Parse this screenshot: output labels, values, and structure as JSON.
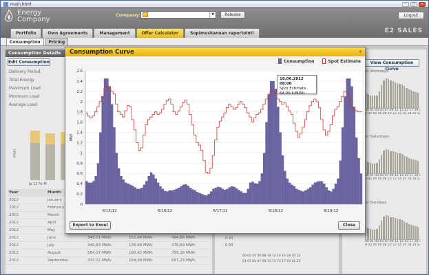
{
  "window": {
    "title": "main.html"
  },
  "header": {
    "logo_line1": "Energy",
    "logo_line2": "Company",
    "company_label": "Company:",
    "company_value": "",
    "release_label": "Release",
    "logout_label": "Logout",
    "brand_right": "E2 SALES",
    "nav_tabs": [
      "Portfolio",
      "Own Agreements",
      "Management",
      "Offer Calculator",
      "Sopimuskannan raportointi"
    ]
  },
  "subtabs": [
    "Consumption",
    "Pricing"
  ],
  "details": {
    "title": "Consumption Details",
    "edit_label": "Edit Consumption",
    "fields": [
      "Delivery Period",
      "Total Energy",
      "Maximum Load",
      "Minimum Load",
      "Average Load"
    ],
    "bar_ylabel": "MWh",
    "bar_xlabels": "Ja 12   Fe   M",
    "table_headers": [
      "Year",
      "Month",
      "",
      "",
      ""
    ],
    "table_rows": [
      [
        "2012",
        "January",
        "",
        "",
        ""
      ],
      [
        "2012",
        "February",
        "",
        "",
        ""
      ],
      [
        "2012",
        "March",
        "",
        "",
        ""
      ],
      [
        "2012",
        "April",
        "",
        "",
        ""
      ],
      [
        "2012",
        "May",
        "",
        "",
        ""
      ],
      [
        "2012",
        "June",
        "343,01 MWh",
        "151,64 MWh",
        "494,66 MWh"
      ],
      [
        "2012",
        "July",
        "349,83 MWh",
        "126,98 MWh",
        "476,69 MWh"
      ],
      [
        "2012",
        "August",
        "584,07 MWh",
        "180,42 MWh",
        "755,16 MWh"
      ],
      [
        "2012",
        "September",
        "332,12 MWh",
        "164,98 MWh",
        "697,23 MWh"
      ]
    ]
  },
  "right_panel": {
    "view_curve_label": "View Consumption Curve",
    "mini_captions": [
      "er Workdays",
      "er Saturdays",
      "er Sundays"
    ],
    "mini_axis": "00 01 03 05 07 09 11 13 15 17 19 21 23",
    "mini_axis2": "0 02 04 06 08 10 12 14 16 18 20 22",
    "mid_axis": "00 02 04 06 08 10 12 14 16 18 20 22",
    "mid_axis2": "01 03 05 07 09 11 13 15 17 19 21 23",
    "mid_ticks": [
      "0.20",
      "0.00"
    ]
  },
  "modal": {
    "title": "Consumption Curve",
    "close_x": "×",
    "legend": [
      "Consumption",
      "Spot Estimate"
    ],
    "tooltip": {
      "line1": "18.06.2012 08:00",
      "line2": "Spot Estimate",
      "line3": "64,99 €/MWh"
    },
    "export_label": "Export to Excel",
    "close_label": "Close"
  },
  "chart_data": {
    "type": "area",
    "ylabel": "MW",
    "ylim": [
      0,
      2.6
    ],
    "yticks": [
      "0",
      "0.2",
      "0.4",
      "0.6",
      "0.8",
      "1",
      "1.2",
      "1.4",
      "1.6",
      "1.8",
      "2",
      "2.2",
      "2.4",
      "2.6"
    ],
    "xticks": [
      "6/15/12",
      "6/16/12",
      "6/17/12",
      "6/18/12",
      "6/19/12"
    ],
    "x": [
      0,
      1,
      2,
      3,
      4,
      5,
      6,
      7,
      8,
      9,
      10,
      11,
      12,
      13,
      14,
      15,
      16,
      17,
      18,
      19,
      20,
      21,
      22,
      23,
      24,
      25,
      26,
      27,
      28,
      29,
      30,
      31,
      32,
      33,
      34,
      35,
      36,
      37,
      38,
      39,
      40,
      41,
      42,
      43,
      44,
      45,
      46,
      47,
      48,
      49,
      50,
      51,
      52,
      53,
      54,
      55,
      56,
      57,
      58,
      59,
      60,
      61,
      62,
      63,
      64,
      65,
      66,
      67,
      68,
      69,
      70,
      71,
      72,
      73,
      74,
      75,
      76,
      77,
      78,
      79,
      80,
      81,
      82,
      83,
      84,
      85,
      86,
      87,
      88,
      89,
      90,
      91,
      92,
      93,
      94,
      95,
      96,
      97,
      98,
      99,
      100,
      101,
      102,
      103,
      104,
      105,
      106,
      107,
      108,
      109,
      110,
      111,
      112,
      113,
      114,
      115,
      116,
      117,
      118,
      119
    ],
    "series": [
      {
        "name": "Consumption",
        "color": "#6a64a0",
        "values": [
          0.45,
          0.42,
          0.42,
          0.45,
          0.55,
          0.8,
          1.4,
          2.1,
          2.45,
          2.45,
          2.3,
          1.95,
          1.5,
          1.0,
          0.7,
          0.55,
          0.48,
          0.42,
          0.4,
          0.38,
          0.36,
          0.33,
          0.3,
          0.3,
          0.32,
          0.38,
          0.45,
          0.55,
          0.62,
          0.58,
          0.5,
          0.42,
          0.35,
          0.3,
          0.26,
          0.25,
          0.27,
          0.27,
          0.28,
          0.3,
          0.32,
          0.35,
          0.38,
          0.39,
          0.36,
          0.32,
          0.29,
          0.27,
          0.24,
          0.22,
          0.2,
          0.18,
          0.17,
          0.2,
          0.25,
          0.3,
          0.32,
          0.34,
          0.33,
          0.3,
          0.28,
          0.3,
          0.33,
          0.35,
          0.34,
          0.31,
          0.28,
          0.25,
          0.22,
          0.22,
          0.3,
          0.42,
          0.44,
          0.41,
          0.4,
          0.45,
          0.6,
          1.0,
          1.6,
          2.15,
          2.4,
          2.4,
          2.25,
          1.9,
          1.4,
          0.95,
          0.65,
          0.5,
          0.42,
          0.38,
          0.35,
          0.3,
          0.28,
          0.26,
          0.25,
          0.27,
          0.3,
          0.33,
          0.38,
          0.42,
          0.44,
          0.45,
          0.45,
          0.4,
          0.33,
          0.27,
          0.25,
          0.3,
          0.4,
          0.5,
          0.85,
          1.5,
          2.1,
          2.45,
          2.45,
          2.3,
          1.9,
          1.3,
          0.9,
          0.6
        ]
      },
      {
        "name": "Spot Estimate",
        "color": "#d23a2a",
        "values": [
          1.78,
          1.72,
          1.68,
          1.72,
          1.8,
          1.9,
          2.0,
          2.1,
          2.25,
          2.3,
          2.25,
          2.2,
          2.15,
          1.95,
          1.8,
          1.75,
          1.7,
          1.82,
          1.92,
          1.9,
          1.65,
          1.45,
          1.2,
          1.05,
          1.1,
          1.35,
          1.55,
          1.65,
          1.7,
          1.75,
          1.8,
          1.75,
          1.78,
          1.85,
          1.95,
          2.02,
          2.05,
          1.95,
          1.8,
          1.75,
          1.82,
          1.9,
          1.98,
          2.03,
          1.95,
          1.75,
          1.55,
          1.35,
          1.2,
          1.15,
          1.05,
          0.85,
          0.62,
          0.6,
          0.7,
          0.95,
          1.25,
          1.5,
          1.62,
          1.7,
          1.78,
          1.88,
          1.95,
          1.9,
          1.85,
          1.88,
          1.95,
          2.0,
          1.95,
          1.88,
          1.78,
          1.7,
          1.6,
          1.68,
          1.75,
          1.78,
          1.85,
          1.95,
          2.05,
          2.1,
          2.2,
          2.2,
          2.15,
          2.05,
          2.0,
          1.95,
          1.98,
          1.9,
          1.82,
          1.75,
          1.58,
          1.42,
          1.3,
          1.38,
          1.5,
          1.65,
          1.8,
          1.92,
          2.0,
          2.05,
          2.0,
          1.88,
          1.65,
          1.45,
          1.35,
          1.42,
          1.55,
          1.72,
          1.85,
          1.9,
          2.0,
          2.1,
          2.2,
          2.2,
          2.05,
          1.9,
          1.85,
          1.82,
          1.8,
          1.8
        ]
      }
    ]
  }
}
